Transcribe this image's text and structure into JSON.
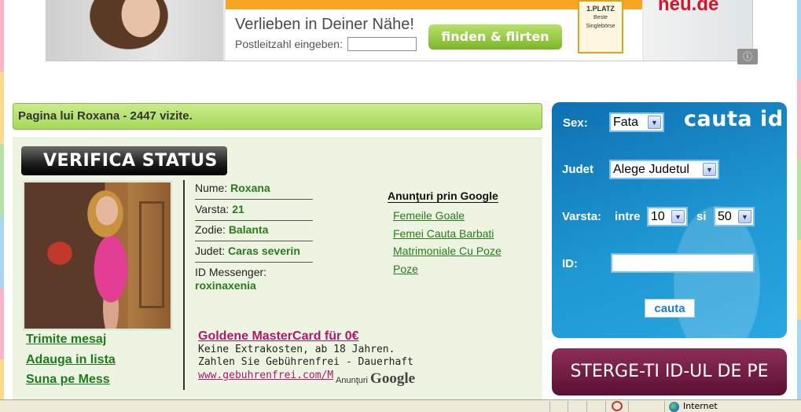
{
  "banner": {
    "headline": "Verlieben in Deiner Nähe!",
    "zip_label": "Postleitzahl eingeben:",
    "zip_value": "",
    "cta": "finden & flirten",
    "badge_title": "1.PLATZ",
    "badge_sub": "Beste Singlebörse",
    "logo": "neu.de",
    "info_icon": "info-icon"
  },
  "page": {
    "title": "Pagina lui Roxana - 2447 vizite."
  },
  "profile": {
    "verify_label": "VERIFICA STATUS",
    "fields": {
      "nume_label": "Nume:",
      "nume": "Roxana",
      "varsta_label": "Varsta:",
      "varsta": "21",
      "zodie_label": "Zodie:",
      "zodie": "Balanta",
      "judet_label": "Judet:",
      "judet": "Caras severin",
      "messenger_label": "ID Messenger:",
      "messenger": "roxinaxenia"
    },
    "links": {
      "message": "Trimite mesaj",
      "add_list": "Adauga in lista",
      "call_mess": "Suna pe Mess"
    }
  },
  "google_ads": {
    "title": "Anunţuri prin Google",
    "links": [
      "Femeile Goale",
      "Femei Cauta Barbati",
      "Matrimoniale Cu Poze",
      "Poze"
    ]
  },
  "text_ad": {
    "title": "Goldene MasterCard für 0€",
    "body": "Keine Extrakosten, ab 18 Jahren. Zahlen Sie Gebührenfrei - Dauerhaft",
    "url": "www.gebuhrenfrei.com/Ma",
    "attribution": "Anunţuri",
    "attribution_brand": "Google"
  },
  "search": {
    "title": "cauta id",
    "sex_label": "Sex:",
    "sex_value": "Fata",
    "judet_label": "Judet",
    "judet_value": "Alege Judetul",
    "varsta_label": "Varsta:",
    "between_label": "intre",
    "age_from": "10",
    "and_label": "si",
    "age_to": "50",
    "id_label": "ID:",
    "id_value": "",
    "button": "cauta"
  },
  "delete_banner": "STERGE-TI ID-UL DE PE SITE",
  "status_bar": {
    "zone": "Internet"
  }
}
